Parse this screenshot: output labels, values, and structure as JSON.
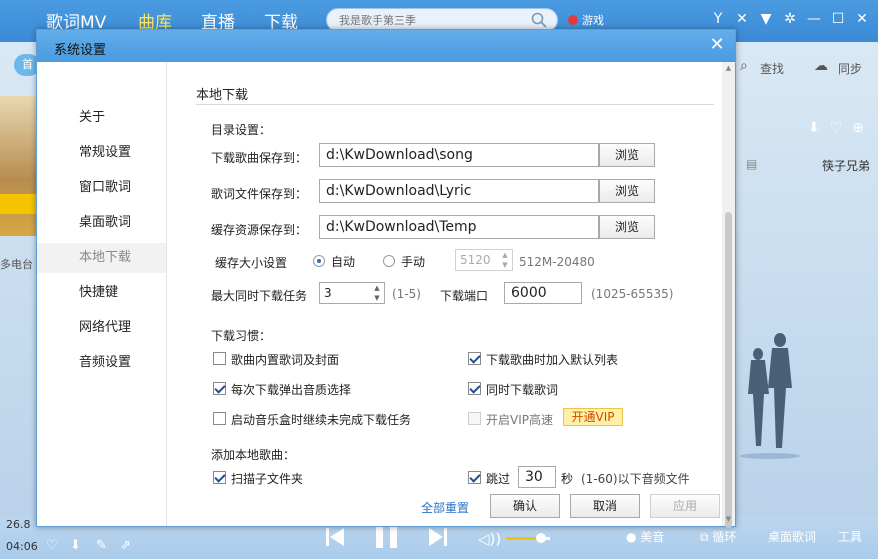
{
  "app": {
    "nav": [
      "歌词MV",
      "曲库",
      "直播",
      "下载"
    ],
    "active_nav": "曲库",
    "search_placeholder": "我是歌手第三季",
    "game_label": "游戏",
    "left_pill": "首",
    "left_label": "多电台",
    "right_tools": [
      "查找",
      "同步"
    ],
    "right_song": "筷子兄弟",
    "player": {
      "time": "04:06",
      "time_top": "26.8",
      "labels": [
        "美音",
        "循环",
        "桌面歌词",
        "工具"
      ]
    }
  },
  "dialog": {
    "title": "系统设置",
    "sidebar": [
      "关于",
      "常规设置",
      "窗口歌词",
      "桌面歌词",
      "本地下载",
      "快捷键",
      "网络代理",
      "音频设置"
    ],
    "active_item": "本地下载",
    "section_title": "本地下载",
    "dir": {
      "heading": "目录设置：",
      "song_label": "下载歌曲保存到：",
      "song_path": "d:\\KwDownload\\song",
      "lyric_label": "歌词文件保存到：",
      "lyric_path": "d:\\KwDownload\\Lyric",
      "cache_label": "缓存资源保存到：",
      "cache_path": "d:\\KwDownload\\Temp",
      "browse": "浏览"
    },
    "cache": {
      "label": "缓存大小设置",
      "auto": "自动",
      "manual": "手动",
      "size": "5120",
      "range": "512M-20480"
    },
    "tasks": {
      "label": "最大同时下载任务",
      "value": "3",
      "range": "(1-5)",
      "port_label": "下载端口",
      "port": "6000",
      "port_range": "(1025-65535)"
    },
    "habits": {
      "heading": "下载习惯：",
      "embed": "歌曲内置歌词及封面",
      "default_list": "下载歌曲时加入默认列表",
      "quality": "每次下载弹出音质选择",
      "lyrics": "同时下载歌词",
      "resume": "启动音乐盒时继续未完成下载任务",
      "vip_speed": "开启VIP高速",
      "vip_button": "开通VIP"
    },
    "local": {
      "heading": "添加本地歌曲：",
      "scan": "扫描子文件夹",
      "skip": "跳过",
      "skip_value": "30",
      "skip_unit": "秒",
      "skip_range": "(1-60)以下音频文件"
    },
    "footer": {
      "reset": "全部重置",
      "ok": "确认",
      "cancel": "取消",
      "apply": "应用"
    }
  }
}
